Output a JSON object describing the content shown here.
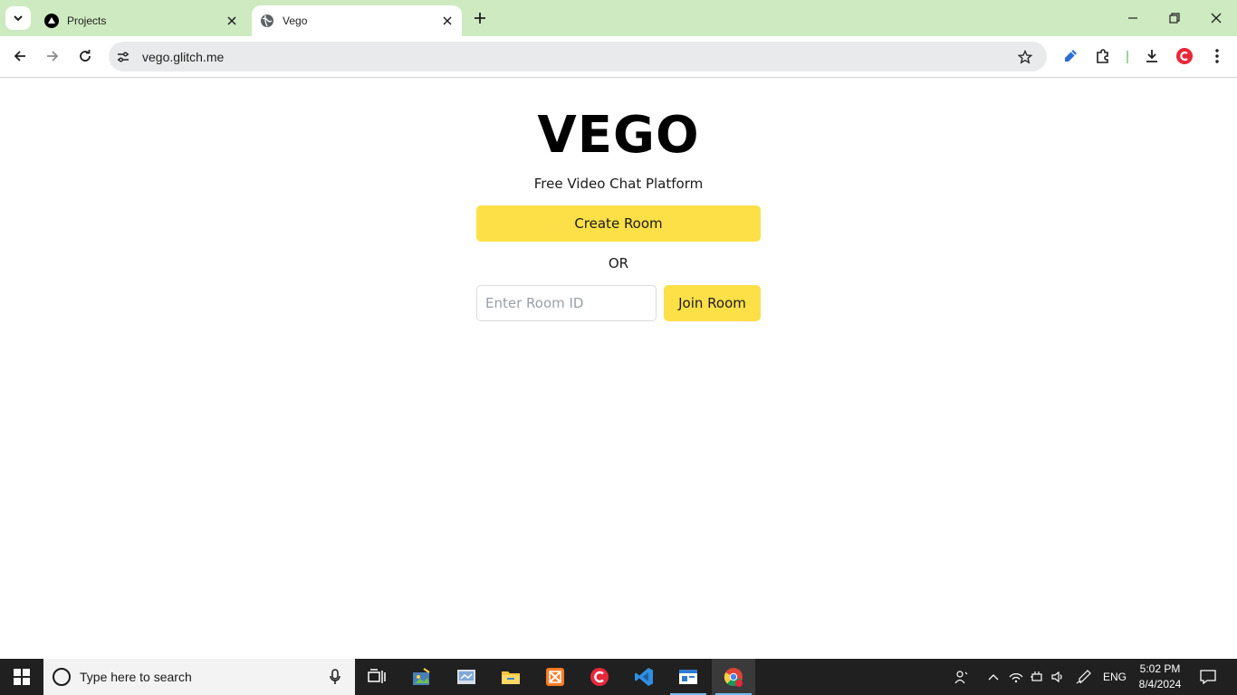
{
  "browser": {
    "tabs": [
      {
        "title": "Projects",
        "favicon": "vercel-triangle-icon",
        "active": false
      },
      {
        "title": "Vego",
        "favicon": "globe-icon",
        "active": true
      }
    ],
    "url": "vego.glitch.me"
  },
  "page": {
    "brand": "VEGO",
    "tagline": "Free Video Chat Platform",
    "create_button": "Create Room",
    "or_text": "OR",
    "room_input_placeholder": "Enter Room ID",
    "room_input_value": "",
    "join_button": "Join Room",
    "accent_color": "#fde047"
  },
  "taskbar": {
    "search_placeholder": "Type here to search",
    "language": "ENG",
    "time": "5:02 PM",
    "date": "8/4/2024",
    "color": "#202020"
  },
  "theme": {
    "tabstrip_color": "#cdeac0",
    "profile_color": "#e8283a"
  }
}
